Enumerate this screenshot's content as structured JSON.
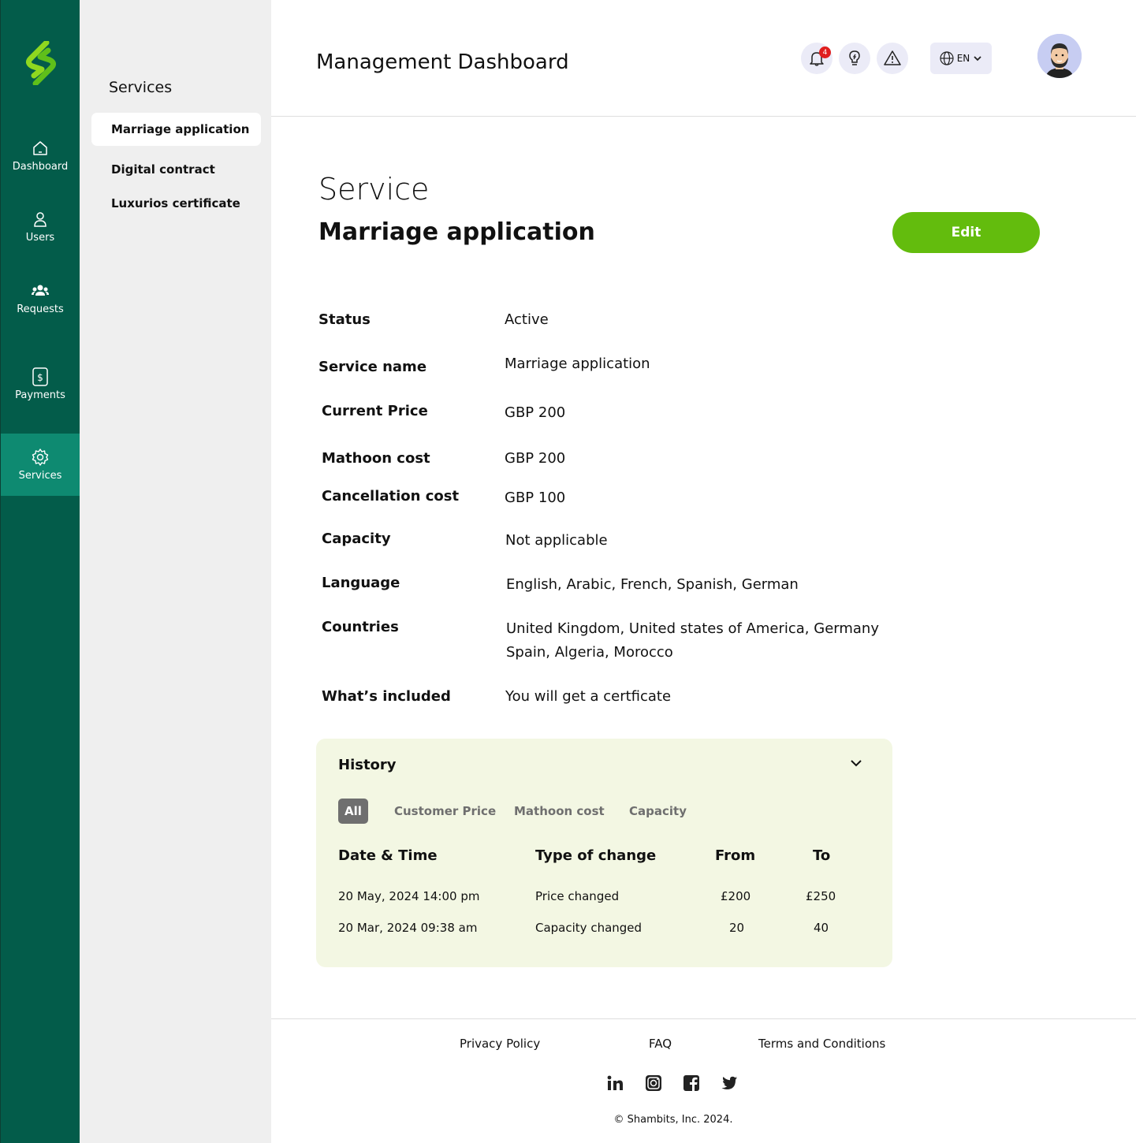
{
  "nav": {
    "items": [
      {
        "label": "Dashboard",
        "icon": "home-icon"
      },
      {
        "label": "Users",
        "icon": "user-icon"
      },
      {
        "label": "Requests",
        "icon": "people-icon"
      },
      {
        "label": "Payments",
        "icon": "dollar-icon"
      },
      {
        "label": "Services",
        "icon": "gear-icon",
        "active": true
      }
    ]
  },
  "subnav": {
    "title": "Services",
    "items": [
      {
        "label": "Marriage application",
        "active": true
      },
      {
        "label": "Digital contract"
      },
      {
        "label": "Luxurios certificate"
      }
    ]
  },
  "header": {
    "title": "Management Dashboard",
    "notification_count": "4",
    "language": "EN",
    "icons": [
      "bell-icon",
      "lightbulb-icon",
      "warning-icon",
      "globe-icon",
      "chevron-down-icon"
    ]
  },
  "service": {
    "kicker": "Service",
    "title": "Marriage application",
    "edit_label": "Edit",
    "details": [
      {
        "label": "Status",
        "value": "Active"
      },
      {
        "label": "Service name",
        "value": "Marriage application"
      },
      {
        "label": "Current Price",
        "value": "GBP 200"
      },
      {
        "label": "Mathoon cost",
        "value": "GBP 200"
      },
      {
        "label": "Cancellation cost",
        "value": "GBP 100"
      },
      {
        "label": "Capacity",
        "value": "Not applicable"
      },
      {
        "label": "Language",
        "value": "English, Arabic, French, Spanish, German"
      },
      {
        "label": "Countries",
        "value": "United Kingdom, United states of America, Germany",
        "value2": "Spain, Algeria, Morocco"
      },
      {
        "label": "What’s included",
        "value": "You will get a certficate"
      }
    ]
  },
  "history": {
    "title": "History",
    "filters": [
      "All",
      "Customer Price",
      "Mathoon cost",
      "Capacity"
    ],
    "active_filter": "All",
    "columns": [
      "Date & Time",
      "Type of change",
      "From",
      "To"
    ],
    "rows": [
      [
        "20 May, 2024 14:00 pm",
        "Price changed",
        "£200",
        "£250"
      ],
      [
        "20 Mar, 2024 09:38 am",
        "Capacity changed",
        "20",
        "40"
      ]
    ]
  },
  "footer": {
    "links": [
      "Privacy Policy",
      "FAQ",
      "Terms and Conditions"
    ],
    "social": [
      "linkedin-icon",
      "instagram-icon",
      "facebook-icon",
      "twitter-icon"
    ],
    "copyright": "© Shambits, Inc. 2024."
  },
  "colors": {
    "rail": "#035c4a",
    "rail_active": "#0e8a71",
    "accent": "#63bc0d",
    "history_bg": "#f3f7e3",
    "badge": "#e01e1e"
  }
}
